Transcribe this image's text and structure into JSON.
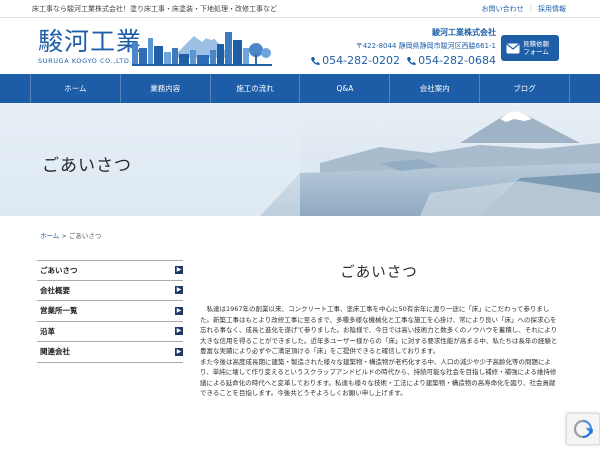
{
  "header": {
    "tagline": "床工事なら駿河工業株式会社！塗り床工事・床塗装・下地処理・改修工事など",
    "top_links": [
      "お問い合わせ",
      "採用情報"
    ],
    "logo_jp": "駿河工業",
    "logo_en": "SURUGA KOGYO CO.,LTD.",
    "company_name": "駿河工業株式会社",
    "address": "〒422-8044 静岡県静岡市駿河区西脇661-1",
    "phone_1": "054-282-0202",
    "phone_2": "054-282-0684",
    "quote_button": {
      "line1": "見積依頼",
      "line2": "フォーム"
    }
  },
  "nav": {
    "items": [
      "ホーム",
      "業務内容",
      "施工の流れ",
      "Q&A",
      "会社案内",
      "ブログ"
    ]
  },
  "hero": {
    "title": "ごあいさつ"
  },
  "breadcrumb": {
    "home": "ホーム",
    "separator": ">",
    "current": "ごあいさつ"
  },
  "sidebar": {
    "items": [
      "ごあいさつ",
      "会社概要",
      "営業所一覧",
      "沿革",
      "関連会社"
    ]
  },
  "main": {
    "title": "ごあいさつ",
    "paragraph_1": "　私達は1967年の創業以来、コンクリート工事、塗床工事を中心に50有余年に渡り一途に「床」にこだわって参りました。新築工事はもとより改修工事に至るまで、多種多様な機械化と工事な施工を心掛け、常により良い「床」への探求心を忘れる事なく、成長と進化を遂げて参りました。お陰様で、今日では高い技術力と数多くのノウハウを蓄積し、それにより大きな信用を得ることができました。近年多ユーザー様からの「床」に対する要求性能が高まる中、私たちは長年の経験と豊富な実績により必ずやご満足頂ける「床」をご提供できると確信しております。",
    "paragraph_2": "また今後は高度成長期に建築・製造された様々な建築物・構造物が老朽化する中、人口の減少や少子高齢化等の問題により、単純に壊して作り変えるというスクラップアンドビルドの時代から、持続可能な社会を目指し補修・補強による維持修繕による延命化の時代へと変革しております。私達も様々な技術・工法により建築物・構造物の高寿命化を図り、社会貢献できることを目指します。今後共どうぞよろしくお願い申し上げます。"
  },
  "colors": {
    "brand": "#1f5fa8",
    "nav": "#1d5ca6",
    "sidebar_arrow": "#1f3a66"
  },
  "icons": [
    "phone-icon",
    "mail-icon",
    "arrow-right-icon",
    "recaptcha-icon"
  ]
}
